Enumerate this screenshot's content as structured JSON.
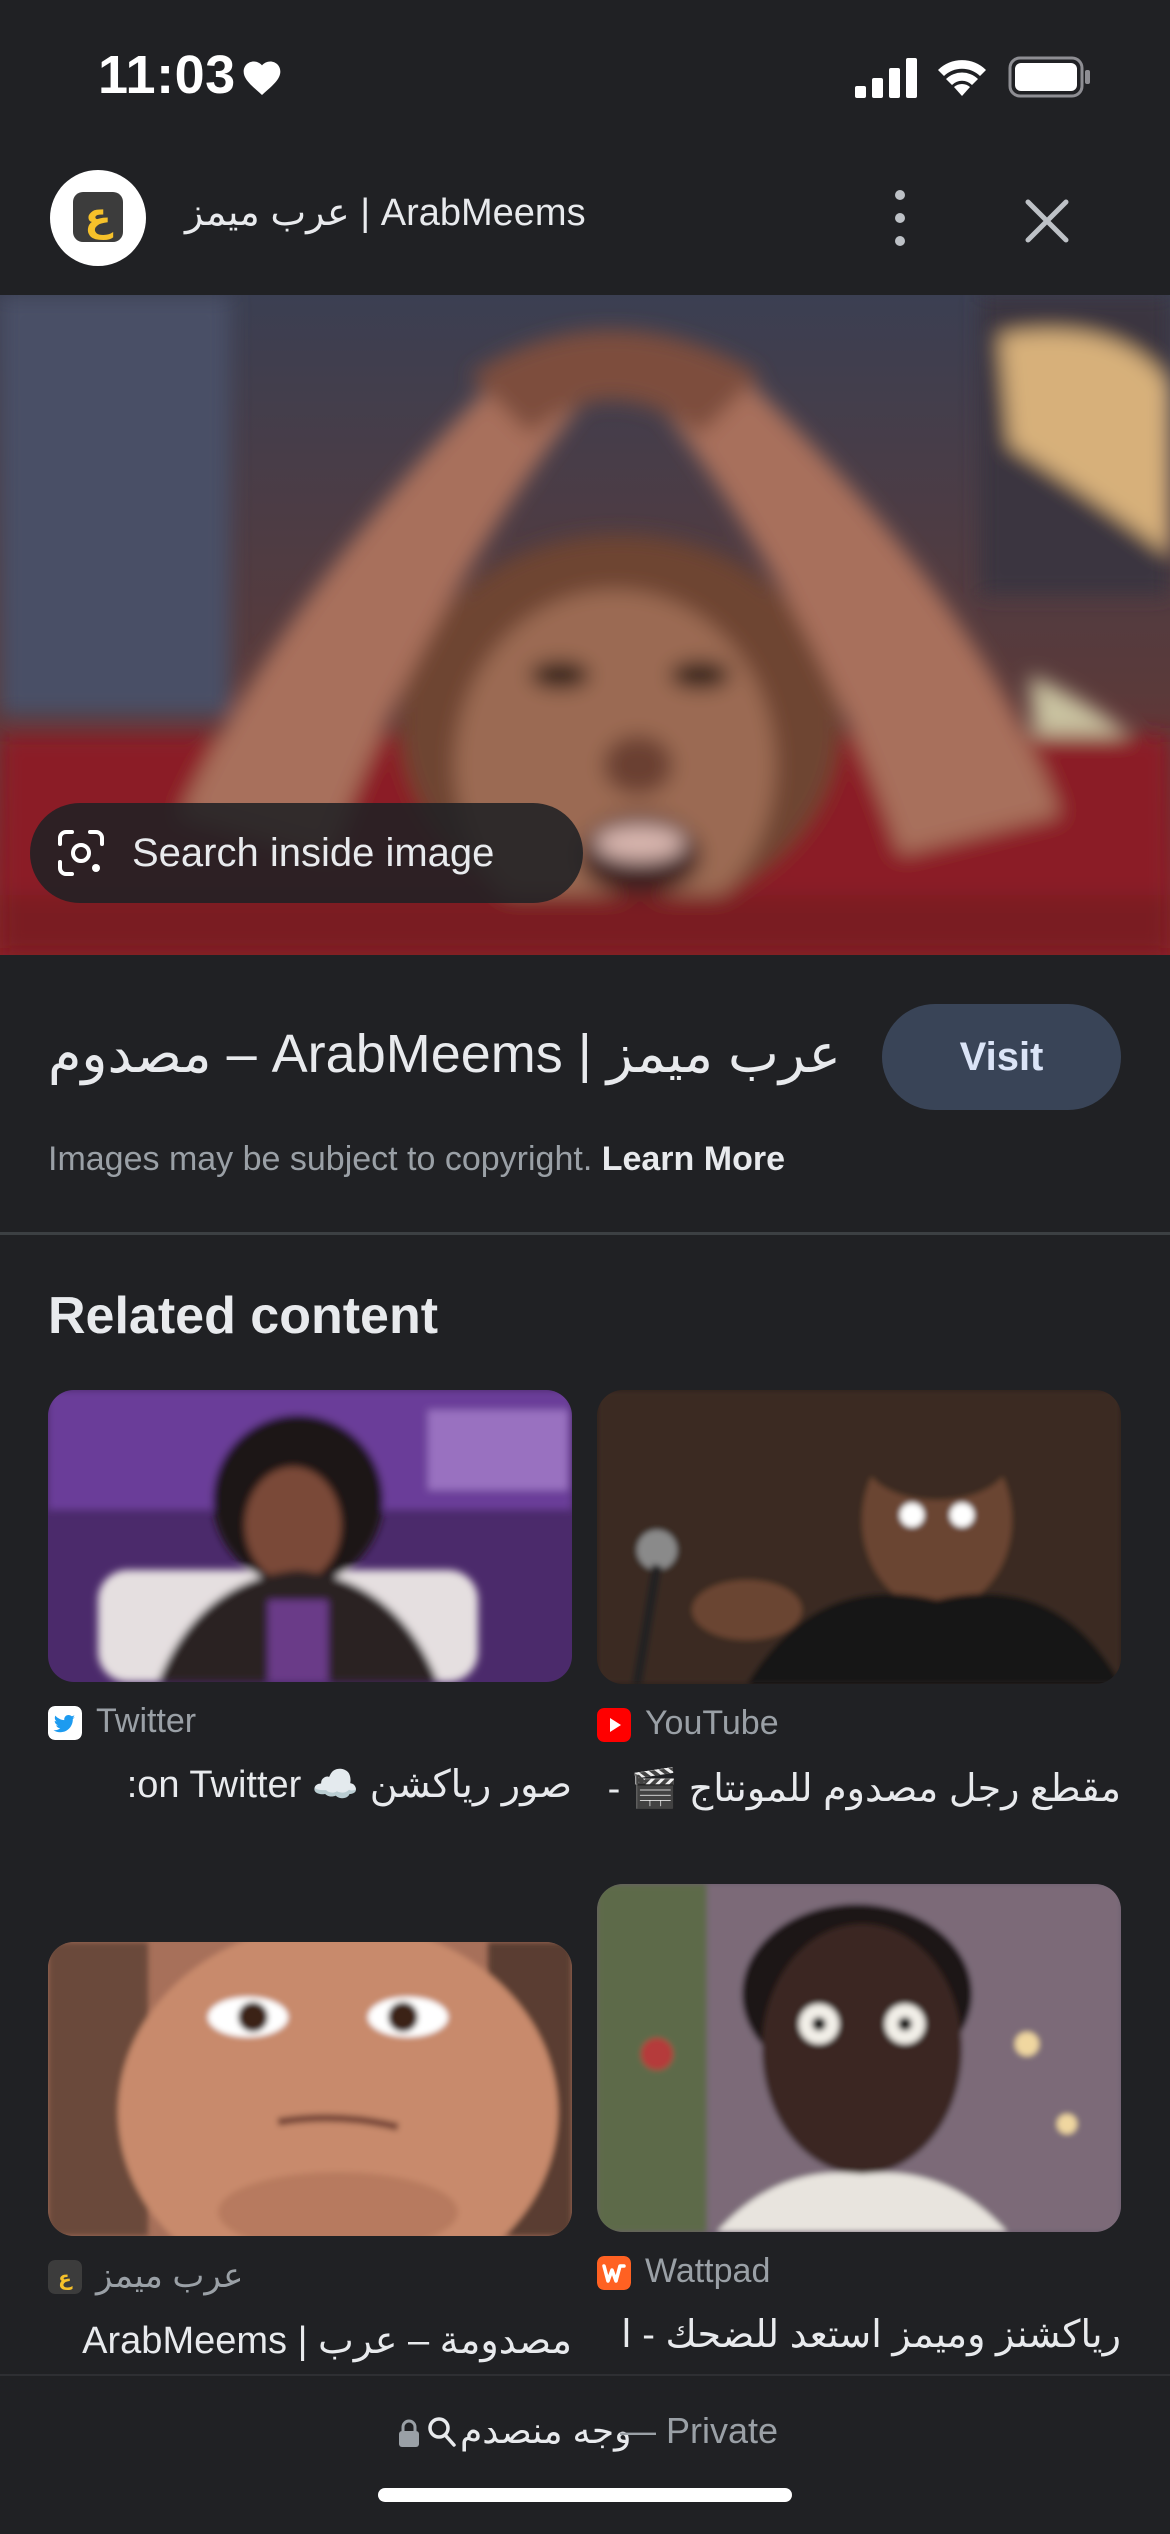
{
  "status_bar": {
    "time": "11:03",
    "icons": [
      "heart-icon",
      "cellular-signal-icon",
      "wifi-icon",
      "battery-icon"
    ]
  },
  "header": {
    "site_title": "عرب ميمز | ArabMeems",
    "logo_glyph": "ع",
    "logo_color": "#f6c12a",
    "more_icon": "more-vertical-icon",
    "close_icon": "close-icon"
  },
  "hero": {
    "search_inside_label": "Search inside image",
    "search_inside_icon": "google-lens-icon"
  },
  "info": {
    "title": "عرب ميمز | ArabMeems – مصدوم",
    "visit_label": "Visit",
    "copyright_text": "Images may be subject to copyright.",
    "learn_more": "Learn More"
  },
  "related": {
    "heading": "Related content",
    "items": [
      {
        "source": "Twitter",
        "source_icon": "twitter-icon",
        "caption": "صور رياكشن ☁️ on Twitter:"
      },
      {
        "source": "YouTube",
        "source_icon": "youtube-icon",
        "caption": "مقطع رجل مصدوم للمونتاج 🎬 -"
      },
      {
        "source": "عرب ميمز",
        "source_icon": "arabmeems-icon",
        "caption": "مصدومة – عرب | ArabMeems"
      },
      {
        "source": "Wattpad",
        "source_icon": "wattpad-icon",
        "caption": "رياكشنز وميمز استعد للضحك - ا"
      }
    ]
  },
  "address_bar": {
    "query": "وجه منصدم",
    "separator": "—",
    "mode": "Private"
  },
  "colors": {
    "background": "#202124",
    "visit_button": "#394457",
    "muted_text": "#9aa0a6"
  }
}
